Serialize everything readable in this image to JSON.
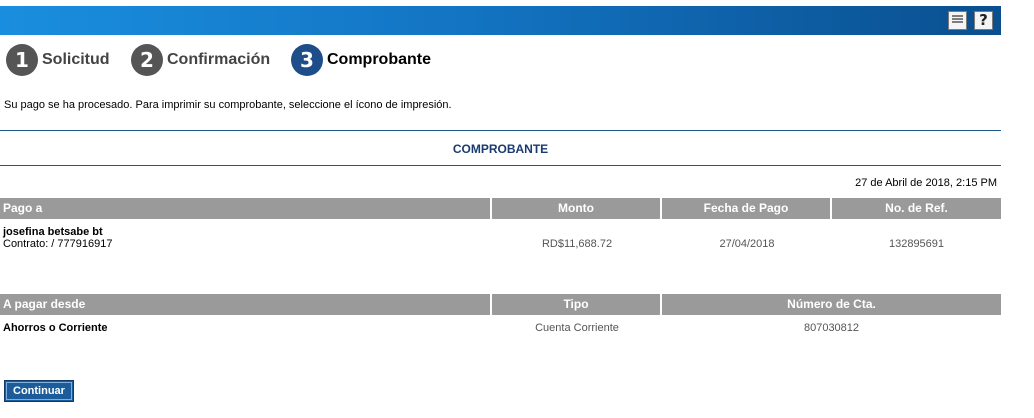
{
  "toolbar": {
    "print_icon": "print-icon",
    "help_icon": "help-icon",
    "help_glyph": "?"
  },
  "steps": [
    {
      "number": "1",
      "label": "Solicitud"
    },
    {
      "number": "2",
      "label": "Confirmación"
    },
    {
      "number": "3",
      "label": "Comprobante"
    }
  ],
  "message": "Su pago se ha procesado. Para imprimir su comprobante, seleccione el ícono de impresión.",
  "section_title": "COMPROBANTE",
  "timestamp": "27 de Abril de 2018, 2:15 PM",
  "payment_table": {
    "headers": [
      "Pago a",
      "Monto",
      "Fecha de Pago",
      "No. de Ref."
    ],
    "payee_name": "josefina betsabe bt",
    "contract": "Contrato: / 777916917",
    "amount": "RD$11,688.72",
    "date": "27/04/2018",
    "reference": "132895691"
  },
  "source_table": {
    "headers": [
      "A pagar desde",
      "Tipo",
      "Número de Cta."
    ],
    "account_name": "Ahorros o Corriente",
    "type": "Cuenta Corriente",
    "account_number": "807030812"
  },
  "continue_label": "Continuar",
  "colors": {
    "header_blue": "#1375c4",
    "table_header": "#9a9a9a",
    "accent": "#1d4e8a"
  }
}
